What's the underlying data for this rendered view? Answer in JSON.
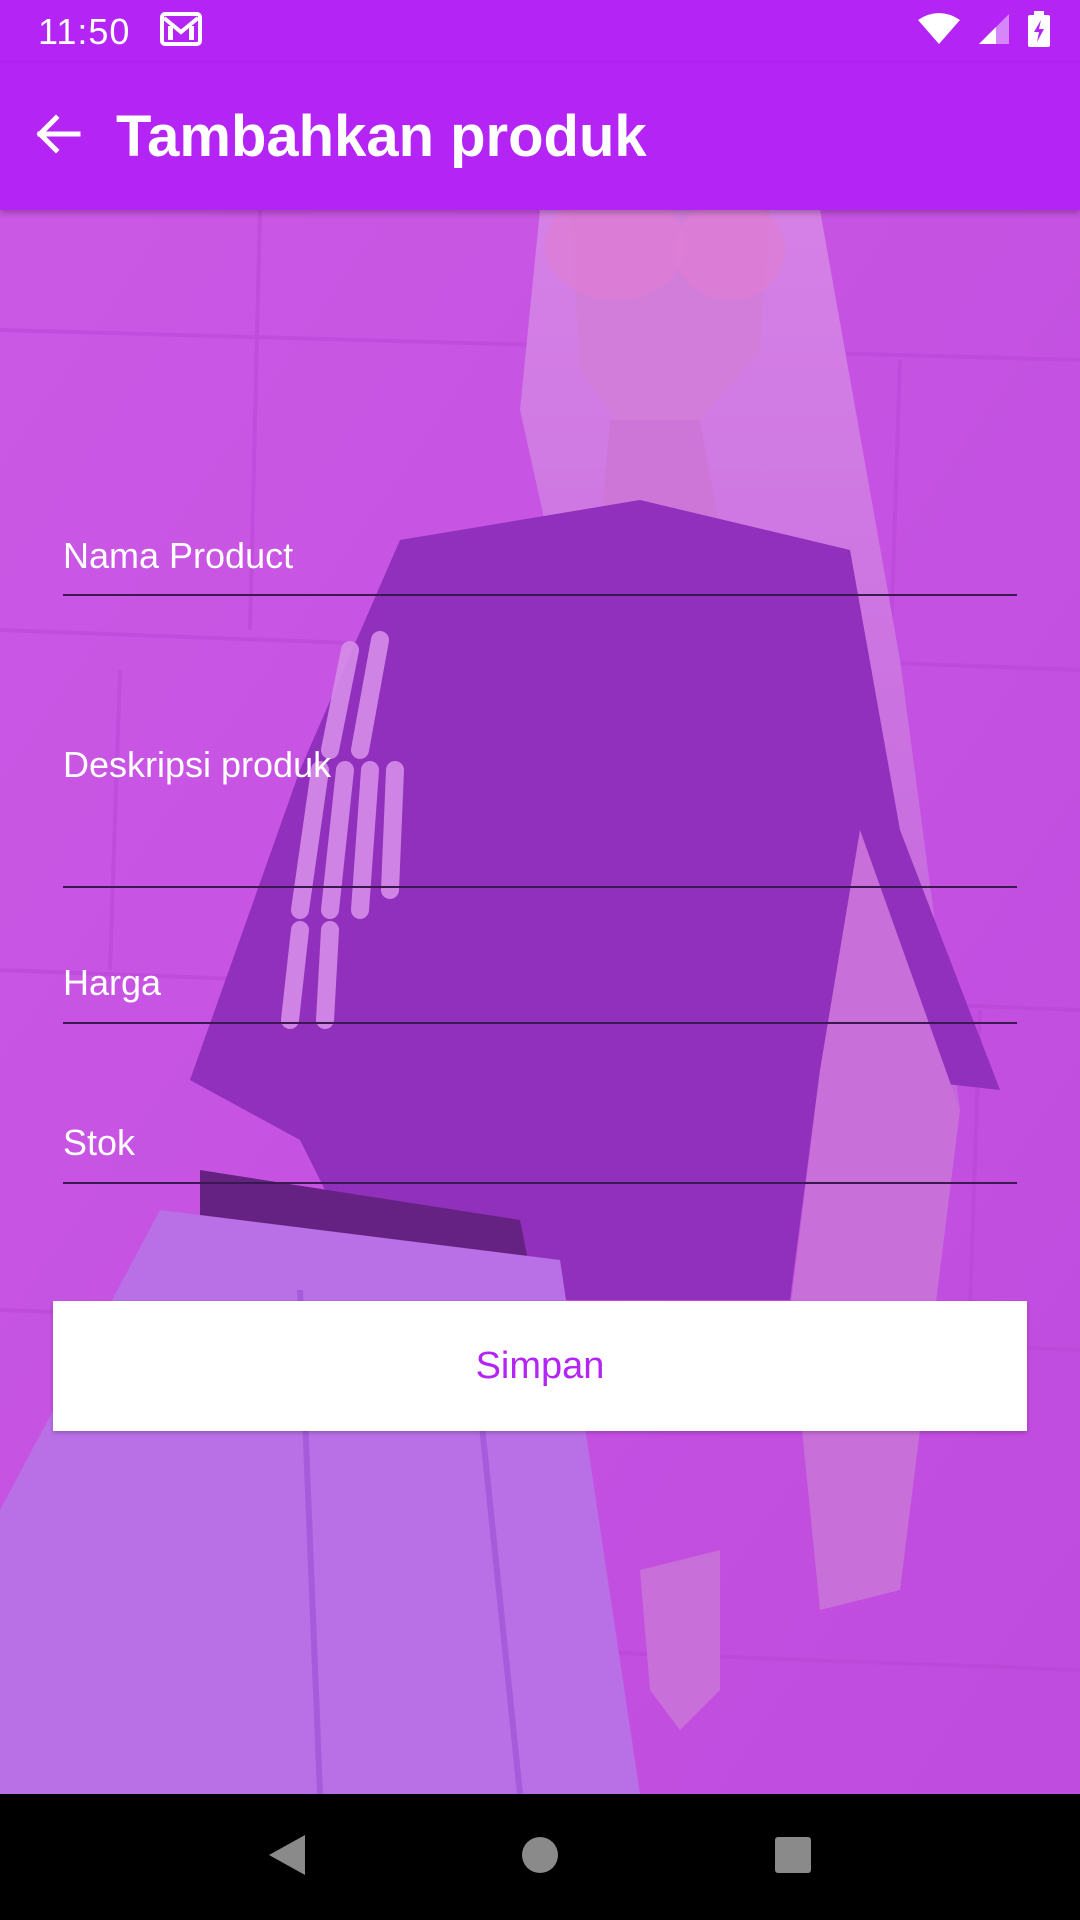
{
  "status_bar": {
    "time": "11:50",
    "notification_icon": "gmail-icon",
    "icons": [
      "wifi-icon",
      "cell-signal-icon",
      "battery-charging-icon"
    ]
  },
  "app_bar": {
    "back_icon": "arrow-back-icon",
    "title": "Tambahkan produk",
    "background_color": "#b424f5"
  },
  "form": {
    "nama": {
      "placeholder": "Nama Product",
      "value": ""
    },
    "deskripsi": {
      "placeholder": "Deskripsi produk",
      "value": ""
    },
    "harga": {
      "placeholder": "Harga",
      "value": ""
    },
    "stok": {
      "placeholder": "Stok",
      "value": ""
    },
    "save_label": "Simpan",
    "save_color": "#b424f5"
  },
  "nav_bar": {
    "icons": [
      "nav-back-icon",
      "nav-home-icon",
      "nav-recents-icon"
    ]
  }
}
